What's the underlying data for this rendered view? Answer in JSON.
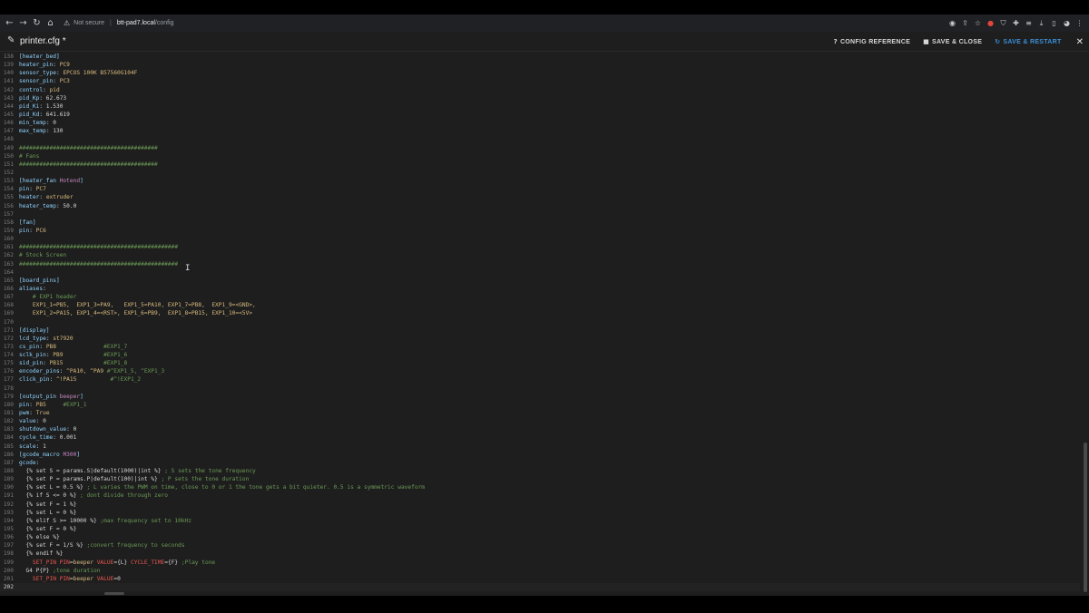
{
  "browser": {
    "security": "Not secure",
    "host": "btt-pad7.local",
    "path": "/config"
  },
  "header": {
    "title": "printer.cfg *",
    "config_reference": "CONFIG REFERENCE",
    "save_close": "SAVE & CLOSE",
    "save_restart": "SAVE & RESTART"
  },
  "editor": {
    "lines": [
      {
        "n": "138",
        "t": [
          [
            "c-sec",
            "[heater_bed]"
          ]
        ]
      },
      {
        "n": "139",
        "t": [
          [
            "c-key",
            "heater_pin"
          ],
          [
            "c-txt",
            ": "
          ],
          [
            "c-val",
            "PC9"
          ]
        ]
      },
      {
        "n": "140",
        "t": [
          [
            "c-key",
            "sensor_type"
          ],
          [
            "c-txt",
            ": "
          ],
          [
            "c-val",
            "EPCOS 100K B57560G104F"
          ]
        ]
      },
      {
        "n": "141",
        "t": [
          [
            "c-key",
            "sensor_pin"
          ],
          [
            "c-txt",
            ": "
          ],
          [
            "c-val",
            "PC3"
          ]
        ]
      },
      {
        "n": "142",
        "t": [
          [
            "c-key",
            "control"
          ],
          [
            "c-txt",
            ": "
          ],
          [
            "c-val",
            "pid"
          ]
        ]
      },
      {
        "n": "143",
        "t": [
          [
            "c-key",
            "pid_Kp"
          ],
          [
            "c-txt",
            ": 62.673"
          ]
        ]
      },
      {
        "n": "144",
        "t": [
          [
            "c-key",
            "pid_Ki"
          ],
          [
            "c-txt",
            ": 1.530"
          ]
        ]
      },
      {
        "n": "145",
        "t": [
          [
            "c-key",
            "pid_Kd"
          ],
          [
            "c-txt",
            ": 641.619"
          ]
        ]
      },
      {
        "n": "146",
        "t": [
          [
            "c-key",
            "min_temp"
          ],
          [
            "c-txt",
            ": 0"
          ]
        ]
      },
      {
        "n": "147",
        "t": [
          [
            "c-key",
            "max_temp"
          ],
          [
            "c-txt",
            ": 130"
          ]
        ]
      },
      {
        "n": "148",
        "t": []
      },
      {
        "n": "149",
        "t": [
          [
            "c-cm",
            "#########################################"
          ]
        ]
      },
      {
        "n": "150",
        "t": [
          [
            "c-cm",
            "# Fans"
          ]
        ]
      },
      {
        "n": "151",
        "t": [
          [
            "c-cm",
            "#########################################"
          ]
        ]
      },
      {
        "n": "152",
        "t": []
      },
      {
        "n": "153",
        "t": [
          [
            "c-sec",
            "[heater_fan "
          ],
          [
            "c-sec-n",
            "Hotend"
          ],
          [
            "c-sec",
            "]"
          ]
        ]
      },
      {
        "n": "154",
        "t": [
          [
            "c-key",
            "pin"
          ],
          [
            "c-txt",
            ": "
          ],
          [
            "c-val",
            "PC7"
          ]
        ]
      },
      {
        "n": "155",
        "t": [
          [
            "c-key",
            "heater"
          ],
          [
            "c-txt",
            ": "
          ],
          [
            "c-val",
            "extruder"
          ]
        ]
      },
      {
        "n": "156",
        "t": [
          [
            "c-key",
            "heater_temp"
          ],
          [
            "c-txt",
            ": 50.0"
          ]
        ]
      },
      {
        "n": "157",
        "t": []
      },
      {
        "n": "158",
        "t": [
          [
            "c-sec",
            "[fan]"
          ]
        ]
      },
      {
        "n": "159",
        "t": [
          [
            "c-key",
            "pin"
          ],
          [
            "c-txt",
            ": "
          ],
          [
            "c-val",
            "PC6"
          ]
        ]
      },
      {
        "n": "160",
        "t": []
      },
      {
        "n": "161",
        "t": [
          [
            "c-cm",
            "###############################################"
          ]
        ]
      },
      {
        "n": "162",
        "t": [
          [
            "c-cm",
            "# Stock Screen"
          ]
        ]
      },
      {
        "n": "163",
        "t": [
          [
            "c-cm",
            "###############################################"
          ]
        ]
      },
      {
        "n": "164",
        "t": []
      },
      {
        "n": "165",
        "t": [
          [
            "c-sec",
            "[board_pins]"
          ]
        ]
      },
      {
        "n": "166",
        "t": [
          [
            "c-key",
            "aliases"
          ],
          [
            "c-txt",
            ":"
          ]
        ]
      },
      {
        "n": "167",
        "t": [
          [
            "c-cm",
            "    # EXP1 header"
          ]
        ]
      },
      {
        "n": "168",
        "t": [
          [
            "c-val",
            "    EXP1_1=PB5,  EXP1_3=PA9,   EXP1_5=PA10, EXP1_7=PB8,  EXP1_9=<GND>,"
          ]
        ]
      },
      {
        "n": "169",
        "t": [
          [
            "c-val",
            "    EXP1_2=PA15, EXP1_4=<RST>, EXP1_6=PB9,  EXP1_8=PB15, EXP1_10=<5V>"
          ]
        ]
      },
      {
        "n": "170",
        "t": []
      },
      {
        "n": "171",
        "t": [
          [
            "c-sec",
            "[display]"
          ]
        ]
      },
      {
        "n": "172",
        "t": [
          [
            "c-key",
            "lcd_type"
          ],
          [
            "c-txt",
            ": "
          ],
          [
            "c-val",
            "st7920"
          ]
        ]
      },
      {
        "n": "173",
        "t": [
          [
            "c-key",
            "cs_pin"
          ],
          [
            "c-txt",
            ": "
          ],
          [
            "c-val",
            "PB8              "
          ],
          [
            "c-cm",
            "#EXP1_7"
          ]
        ]
      },
      {
        "n": "174",
        "t": [
          [
            "c-key",
            "sclk_pin"
          ],
          [
            "c-txt",
            ": "
          ],
          [
            "c-val",
            "PB9            "
          ],
          [
            "c-cm",
            "#EXP1_6"
          ]
        ]
      },
      {
        "n": "175",
        "t": [
          [
            "c-key",
            "sid_pin"
          ],
          [
            "c-txt",
            ": "
          ],
          [
            "c-val",
            "PB15            "
          ],
          [
            "c-cm",
            "#EXP1_8"
          ]
        ]
      },
      {
        "n": "176",
        "t": [
          [
            "c-key",
            "encoder_pins"
          ],
          [
            "c-txt",
            ": "
          ],
          [
            "c-val",
            "^PA10, ^PA9 "
          ],
          [
            "c-cm",
            "#^EXP1_5, ^EXP1_3"
          ]
        ]
      },
      {
        "n": "177",
        "t": [
          [
            "c-key",
            "click_pin"
          ],
          [
            "c-txt",
            ": "
          ],
          [
            "c-val",
            "^!PA15          "
          ],
          [
            "c-cm",
            "#^!EXP1_2"
          ]
        ]
      },
      {
        "n": "178",
        "t": []
      },
      {
        "n": "179",
        "t": [
          [
            "c-sec",
            "[output_pin "
          ],
          [
            "c-sec-n",
            "beeper"
          ],
          [
            "c-sec",
            "]"
          ]
        ]
      },
      {
        "n": "180",
        "t": [
          [
            "c-key",
            "pin"
          ],
          [
            "c-txt",
            ": "
          ],
          [
            "c-val",
            "PB5     "
          ],
          [
            "c-cm",
            "#EXP1_1"
          ]
        ]
      },
      {
        "n": "181",
        "t": [
          [
            "c-key",
            "pwm"
          ],
          [
            "c-txt",
            ": "
          ],
          [
            "c-val",
            "True"
          ]
        ]
      },
      {
        "n": "182",
        "t": [
          [
            "c-key",
            "value"
          ],
          [
            "c-txt",
            ": 0"
          ]
        ]
      },
      {
        "n": "183",
        "t": [
          [
            "c-key",
            "shutdown_value"
          ],
          [
            "c-txt",
            ": 0"
          ]
        ]
      },
      {
        "n": "184",
        "t": [
          [
            "c-key",
            "cycle_time"
          ],
          [
            "c-txt",
            ": 0.001"
          ]
        ]
      },
      {
        "n": "185",
        "t": [
          [
            "c-key",
            "scale"
          ],
          [
            "c-txt",
            ": 1"
          ]
        ]
      },
      {
        "n": "186",
        "t": [
          [
            "c-sec",
            "[gcode_macro "
          ],
          [
            "c-sec-n",
            "M300"
          ],
          [
            "c-sec",
            "]"
          ]
        ]
      },
      {
        "n": "187",
        "t": [
          [
            "c-key",
            "gcode"
          ],
          [
            "c-txt",
            ":"
          ]
        ]
      },
      {
        "n": "188",
        "t": [
          [
            "c-txt",
            "  {% set S = params.S|default(1000)|int %} "
          ],
          [
            "c-cm",
            "; S sets the tone frequency"
          ]
        ]
      },
      {
        "n": "189",
        "t": [
          [
            "c-txt",
            "  {% set P = params.P|default(100)|int %} "
          ],
          [
            "c-cm",
            "; P sets the tone duration"
          ]
        ]
      },
      {
        "n": "190",
        "t": [
          [
            "c-txt",
            "  {% set L = 0.5 %} "
          ],
          [
            "c-cm",
            "; L varies the PWM on time, close to 0 or 1 the tone gets a bit quieter. 0.5 is a symmetric waveform"
          ]
        ]
      },
      {
        "n": "191",
        "t": [
          [
            "c-txt",
            "  {% if S <= 0 %} "
          ],
          [
            "c-cm",
            "; dont divide through zero"
          ]
        ]
      },
      {
        "n": "192",
        "t": [
          [
            "c-txt",
            "  {% set F = 1 %}"
          ]
        ]
      },
      {
        "n": "193",
        "t": [
          [
            "c-txt",
            "  {% set L = 0 %}"
          ]
        ]
      },
      {
        "n": "194",
        "t": [
          [
            "c-txt",
            "  {% elif S >= 10000 %} "
          ],
          [
            "c-cm",
            ";max frequency set to 10kHz"
          ]
        ]
      },
      {
        "n": "195",
        "t": [
          [
            "c-txt",
            "  {% set F = 0 %}"
          ]
        ]
      },
      {
        "n": "196",
        "t": [
          [
            "c-txt",
            "  {% else %}"
          ]
        ]
      },
      {
        "n": "197",
        "t": [
          [
            "c-txt",
            "  {% set F = 1/S %} "
          ],
          [
            "c-cm",
            ";convert frequency to seconds"
          ]
        ]
      },
      {
        "n": "198",
        "t": [
          [
            "c-txt",
            "  {% endif %}"
          ]
        ]
      },
      {
        "n": "199",
        "t": [
          [
            "c-red",
            "    SET_PIN PIN"
          ],
          [
            "c-txt",
            "="
          ],
          [
            "c-val",
            "beeper "
          ],
          [
            "c-red",
            "VALUE"
          ],
          [
            "c-txt",
            "={L} "
          ],
          [
            "c-red",
            "CYCLE_TIME"
          ],
          [
            "c-txt",
            "={F} "
          ],
          [
            "c-cm",
            ";Play tone"
          ]
        ]
      },
      {
        "n": "200",
        "t": [
          [
            "c-txt",
            "  G4 P{P} "
          ],
          [
            "c-cm",
            ";tone duration"
          ]
        ]
      },
      {
        "n": "201",
        "t": [
          [
            "c-red",
            "    SET_PIN PIN"
          ],
          [
            "c-txt",
            "="
          ],
          [
            "c-val",
            "beeper "
          ],
          [
            "c-red",
            "VALUE"
          ],
          [
            "c-txt",
            "=0"
          ]
        ]
      },
      {
        "n": "202",
        "t": []
      }
    ]
  }
}
